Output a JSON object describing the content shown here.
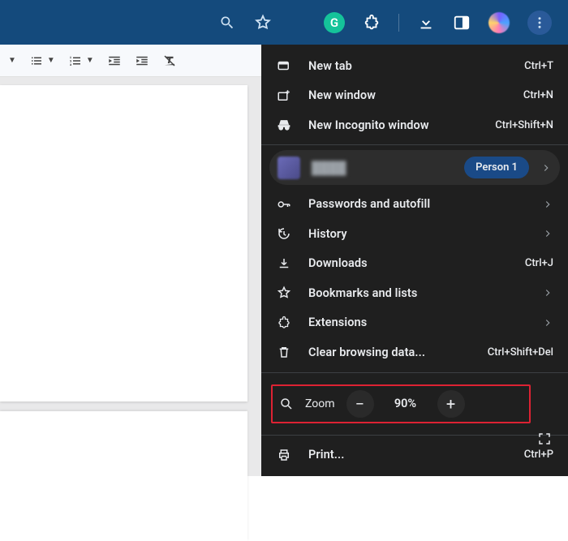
{
  "topbar": {
    "grammarly_glyph": "G"
  },
  "profile": {
    "name": "████",
    "badge": "Person 1"
  },
  "menu": {
    "new_tab": {
      "label": "New tab",
      "hint": "Ctrl+T"
    },
    "new_window": {
      "label": "New window",
      "hint": "Ctrl+N"
    },
    "incognito": {
      "label": "New Incognito window",
      "hint": "Ctrl+Shift+N"
    },
    "passwords": {
      "label": "Passwords and autofill"
    },
    "history": {
      "label": "History"
    },
    "downloads": {
      "label": "Downloads",
      "hint": "Ctrl+J"
    },
    "bookmarks": {
      "label": "Bookmarks and lists"
    },
    "extensions": {
      "label": "Extensions"
    },
    "clear": {
      "label": "Clear browsing data...",
      "hint": "Ctrl+Shift+Del"
    },
    "zoom": {
      "label": "Zoom",
      "value": "90%"
    },
    "print": {
      "label": "Print...",
      "hint": "Ctrl+P"
    }
  },
  "highlight": {
    "color": "#dd2233"
  }
}
